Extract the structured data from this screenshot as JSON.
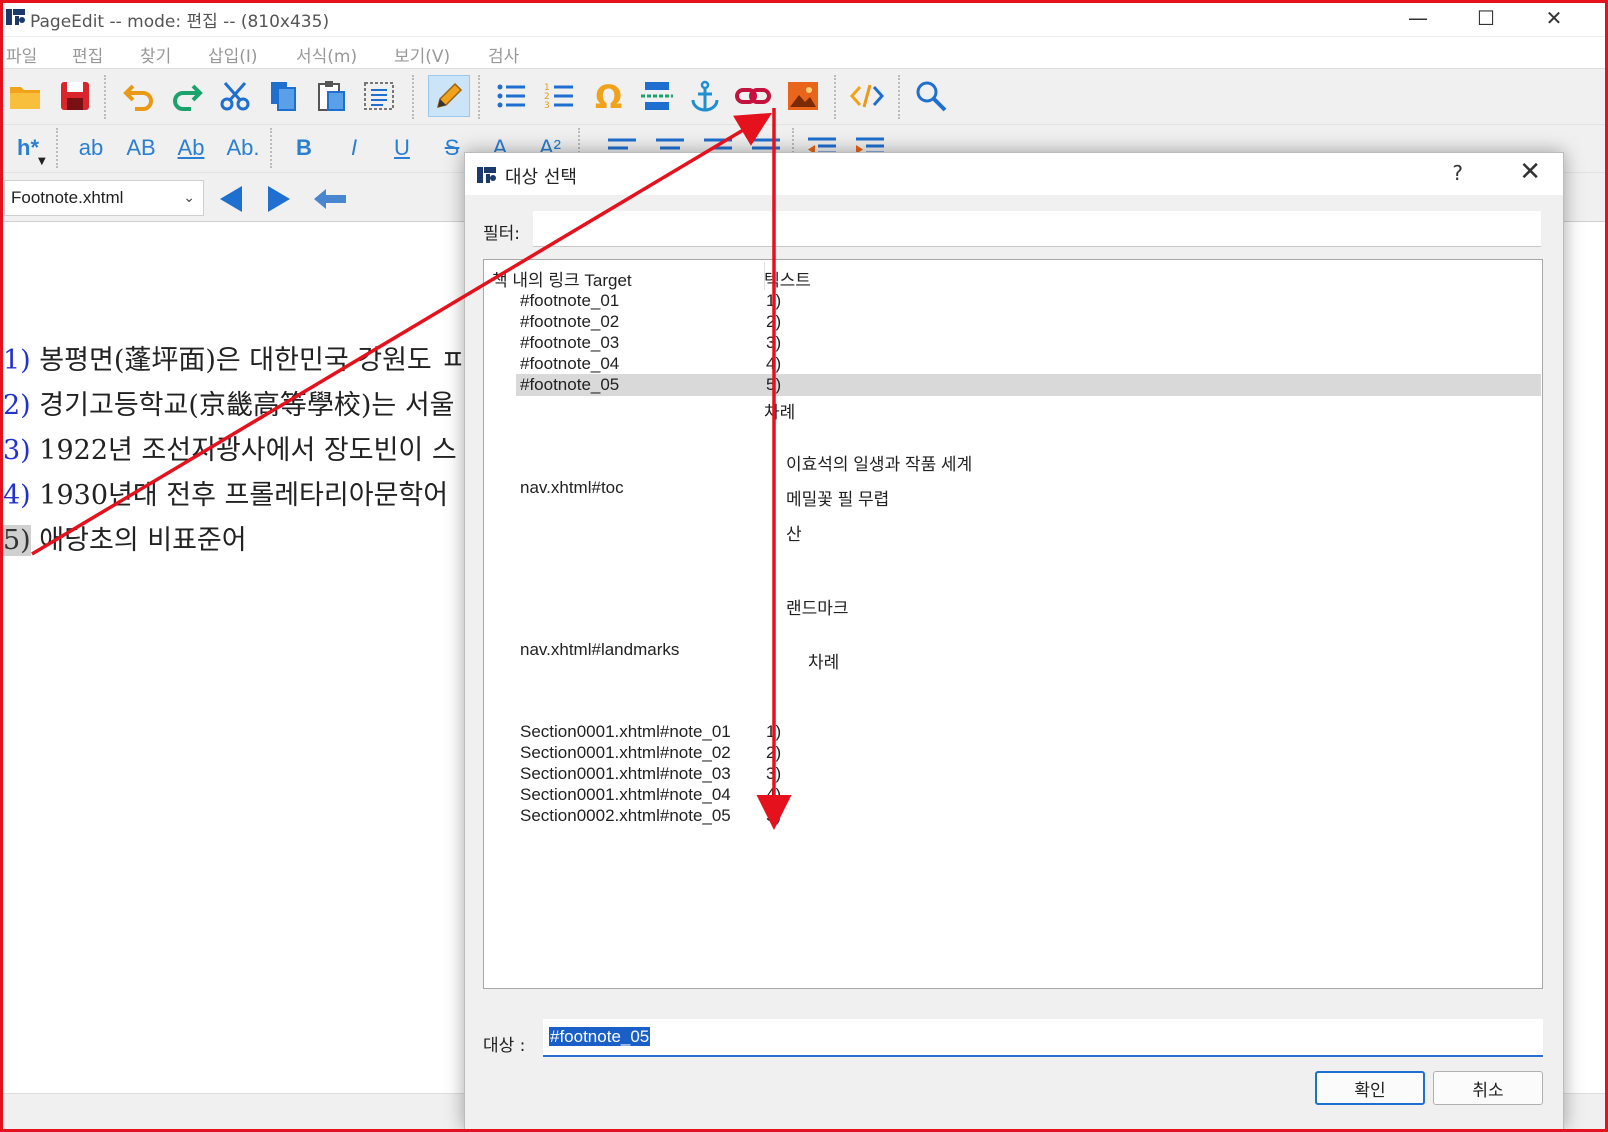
{
  "window": {
    "title": "PageEdit -- mode: 편집 -- (810x435)",
    "minimize": "—",
    "maximize": "☐",
    "close": "✕"
  },
  "menu": [
    "파일",
    "편집",
    "찾기",
    "삽입(I)",
    "서식(m)",
    "보기(V)",
    "검사"
  ],
  "format_toolbar": {
    "heading": "h*",
    "lower": "ab",
    "upper": "AB",
    "title": "Ab",
    "sentence": "Ab.",
    "bold": "B",
    "italic": "I",
    "underline": "U",
    "strike": "S",
    "subscript": "A",
    "superscript": "A²"
  },
  "file_select": {
    "value": "Footnote.xhtml"
  },
  "editor": {
    "lines": [
      {
        "num": "1)",
        "text": " 봉평면(蓬坪面)은 대한민국 강원도 ㅍ"
      },
      {
        "num": "2)",
        "text": " 경기고등학교(京畿高等學校)는 서울"
      },
      {
        "num": "3)",
        "text": " 1922년 조선지광사에서 장도빈이 스"
      },
      {
        "num": "4)",
        "text": " 1930년대 전후 프롤레타리아문학어"
      },
      {
        "num": "5)",
        "text": " 애당초의 비표준어"
      }
    ]
  },
  "dialog": {
    "title": "대상 선택",
    "help": "?",
    "close": "✕",
    "filter_label": "필터:",
    "filter_value": "",
    "col1_header": "책 내의 링크 Target",
    "col2_header": "텍스트",
    "footnote_rows": [
      {
        "target": "#footnote_01",
        "text": "1)"
      },
      {
        "target": "#footnote_02",
        "text": "2)"
      },
      {
        "target": "#footnote_03",
        "text": "3)"
      },
      {
        "target": "#footnote_04",
        "text": "4)"
      },
      {
        "target": "#footnote_05",
        "text": "5)"
      }
    ],
    "toc_heading": "차례",
    "toc_target": "nav.xhtml#toc",
    "toc_items": [
      "이효석의 일생과 작품 세계",
      "메밀꽃 필 무렵",
      "산"
    ],
    "landmarks_heading": "랜드마크",
    "landmarks_target": "nav.xhtml#landmarks",
    "landmarks_item": "차례",
    "note_rows": [
      {
        "target": "Section0001.xhtml#note_01",
        "text": "1)"
      },
      {
        "target": "Section0001.xhtml#note_02",
        "text": "2)"
      },
      {
        "target": "Section0001.xhtml#note_03",
        "text": "3)"
      },
      {
        "target": "Section0001.xhtml#note_04",
        "text": "4)"
      },
      {
        "target": "Section0002.xhtml#note_05",
        "text": "5)"
      }
    ],
    "target_label": "대상 :",
    "target_value": "#footnote_05",
    "ok": "확인",
    "cancel": "취소"
  },
  "colors": {
    "annotation": "#e5111c",
    "accent": "#1e6fd0",
    "footnote_number": "#2233cc"
  }
}
